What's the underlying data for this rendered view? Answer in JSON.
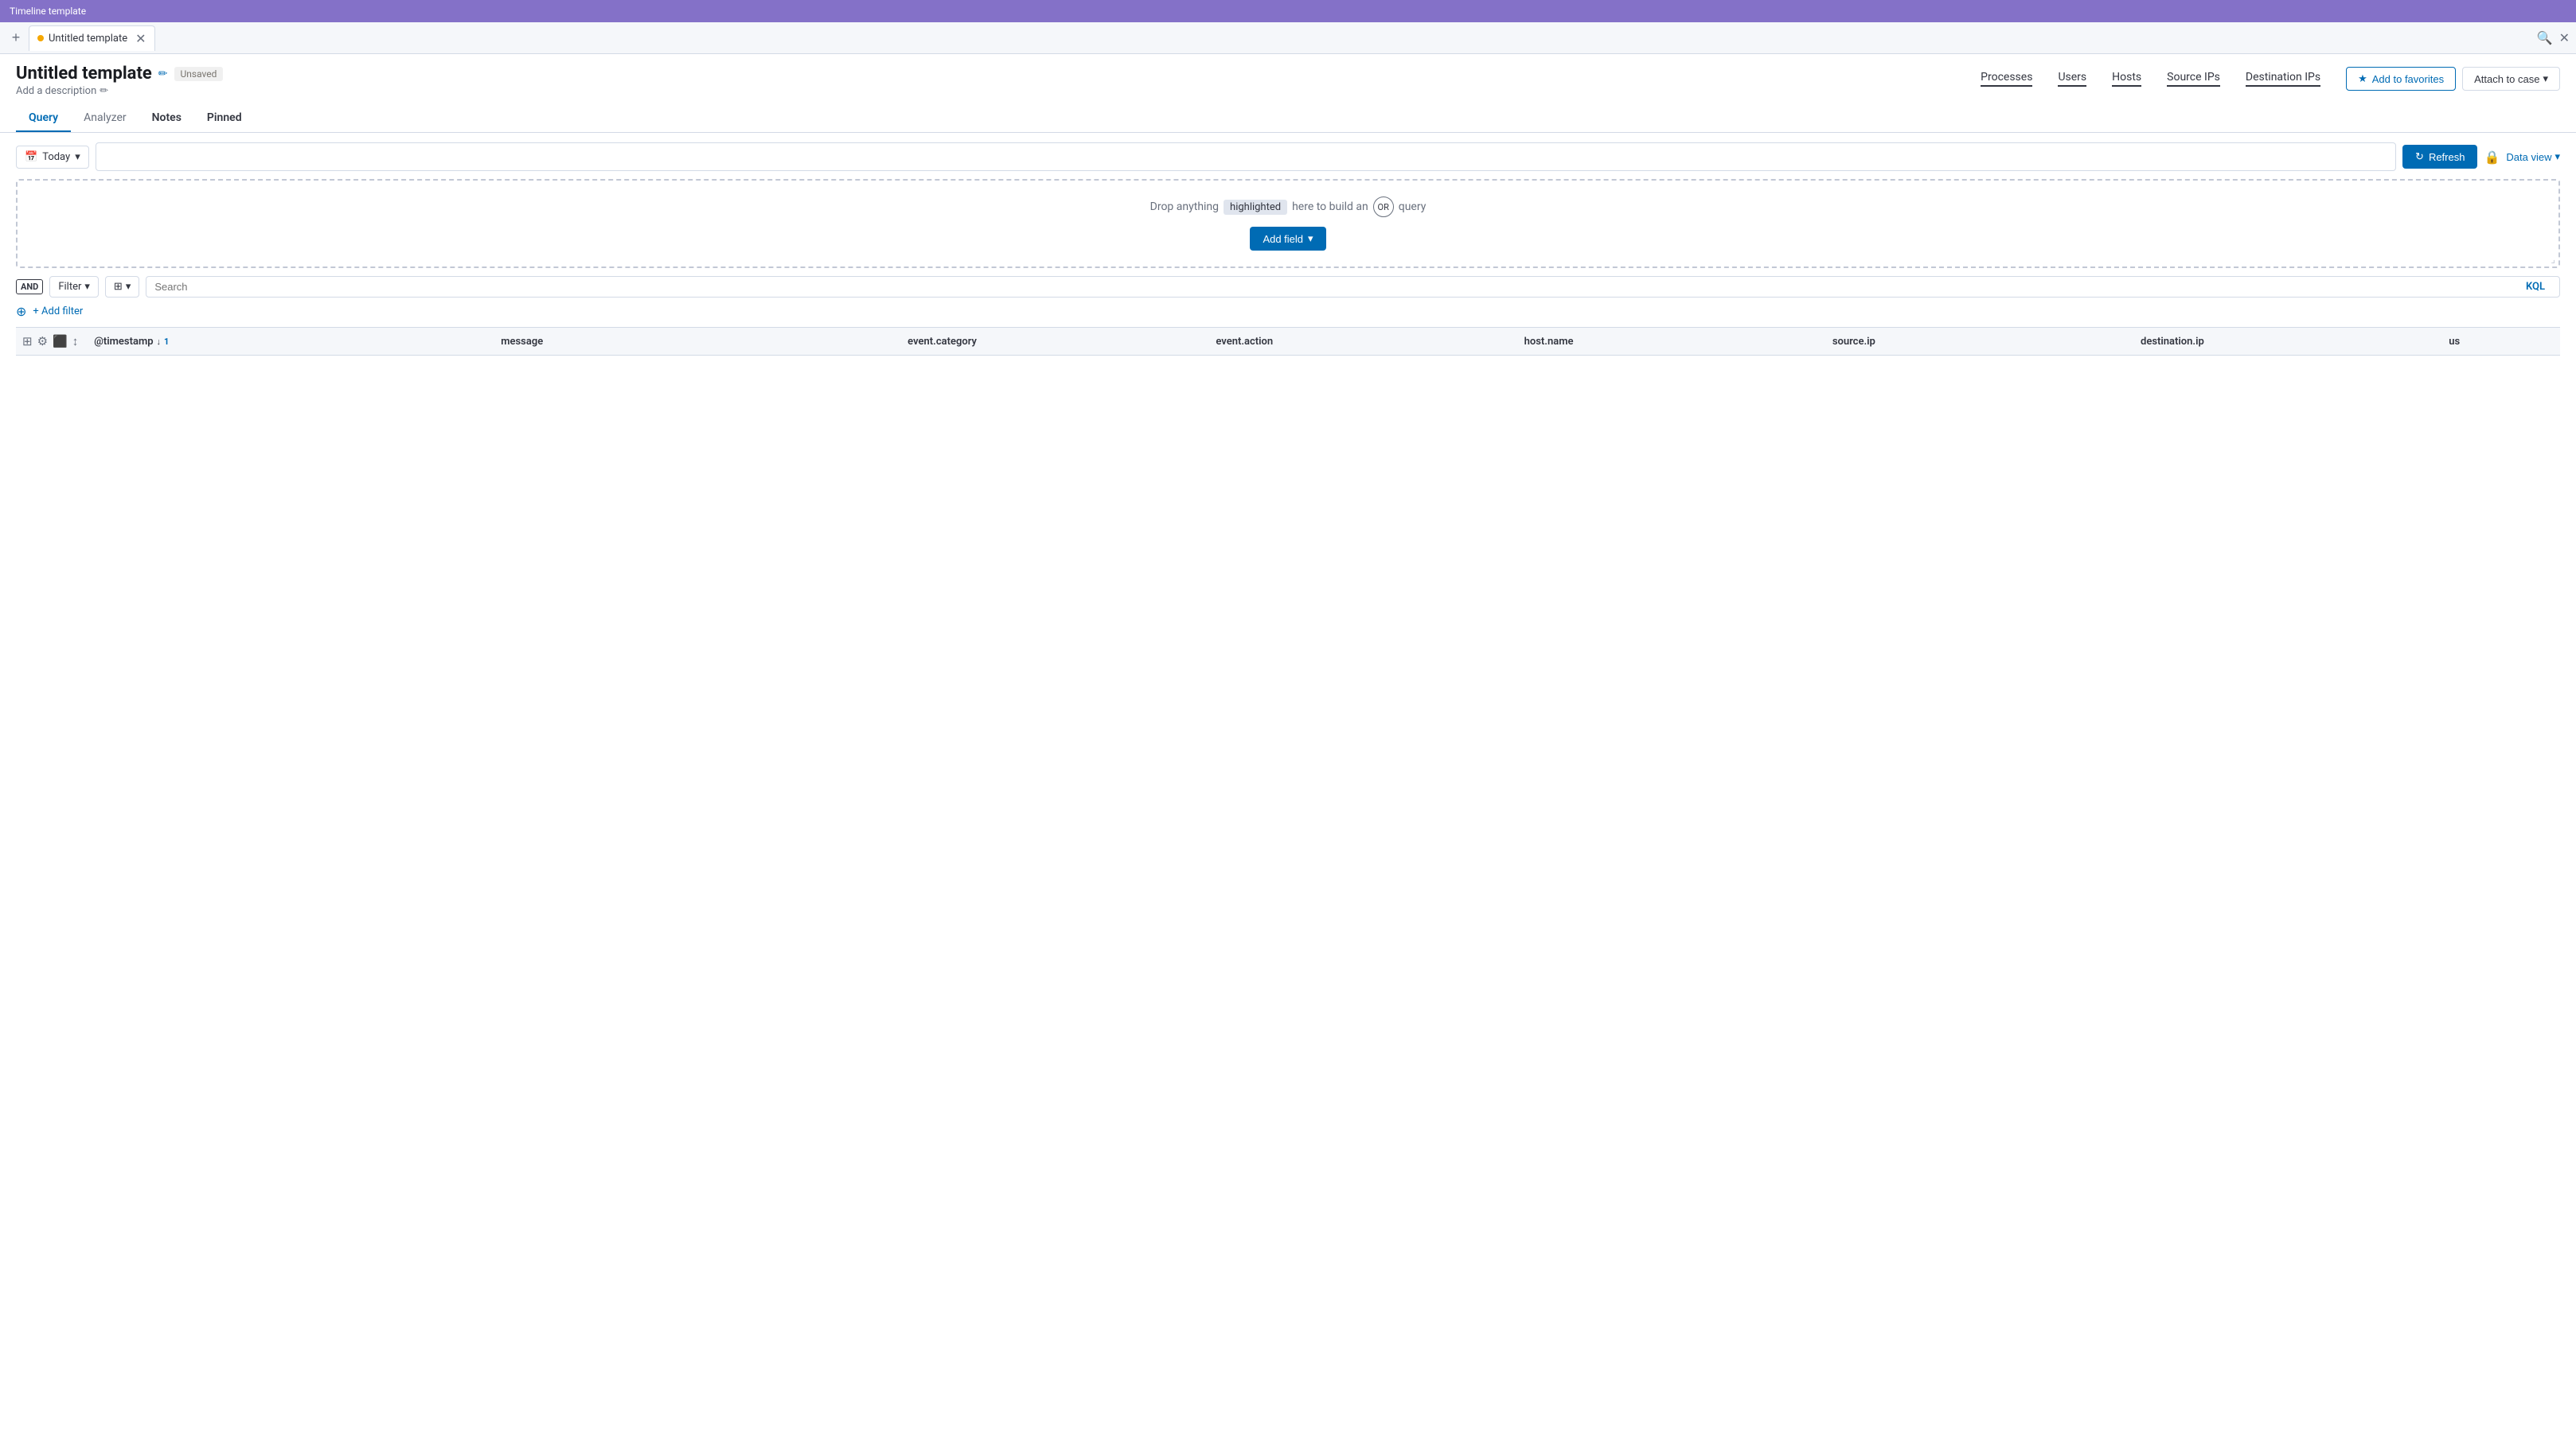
{
  "topBar": {
    "title": "Timeline template"
  },
  "tabs": {
    "addButton": "+",
    "activeTab": {
      "dot": true,
      "label": "Untitled template"
    },
    "actions": {
      "searchIcon": "🔍",
      "closeIcon": "✕"
    }
  },
  "header": {
    "title": "Untitled template",
    "editIcon": "✏",
    "unsavedLabel": "Unsaved",
    "addDescription": "Add a description",
    "pencilIcon": "✏",
    "navMetrics": [
      {
        "label": "Processes"
      },
      {
        "label": "Users"
      },
      {
        "label": "Hosts"
      },
      {
        "label": "Source IPs"
      },
      {
        "label": "Destination IPs"
      }
    ],
    "actions": {
      "starIcon": "★",
      "addToFavorites": "Add to favorites",
      "attachToCase": "Attach to case",
      "chevronIcon": "▾"
    }
  },
  "subTabs": [
    {
      "label": "Query",
      "active": true
    },
    {
      "label": "Analyzer",
      "active": false
    },
    {
      "label": "Notes",
      "active": false,
      "bold": true
    },
    {
      "label": "Pinned",
      "active": false,
      "bold": true
    }
  ],
  "toolbar": {
    "dateIcon": "📅",
    "dateValue": "Today",
    "chevronIcon": "▾",
    "refreshIcon": "↻",
    "refreshLabel": "Refresh",
    "lockIcon": "🔒",
    "dataViewLabel": "Data view",
    "dataViewChevron": "▾"
  },
  "dropZone": {
    "preText": "Drop anything",
    "highlighted": "highlighted",
    "midText": "here to build an",
    "orLabel": "OR",
    "postText": "query",
    "addFieldLabel": "Add field",
    "addFieldChevron": "▾"
  },
  "filterBar": {
    "andLabel": "AND",
    "filterLabel": "Filter",
    "filterChevron": "▾",
    "gridIcon": "⊞",
    "gridChevron": "▾",
    "searchPlaceholder": "Search",
    "kqlLabel": "KQL",
    "addFilterCircleIcon": "⊕",
    "addFilterLabel": "+ Add filter"
  },
  "tableHeader": {
    "controls": [
      "⊞",
      "⚙",
      "⬛",
      "↕"
    ],
    "columns": [
      {
        "key": "@timestamp",
        "label": "@timestamp",
        "sortIcon": "↓",
        "sortNum": "1"
      },
      {
        "key": "message",
        "label": "message"
      },
      {
        "key": "event.category",
        "label": "event.category"
      },
      {
        "key": "event.action",
        "label": "event.action"
      },
      {
        "key": "host.name",
        "label": "host.name"
      },
      {
        "key": "source.ip",
        "label": "source.ip"
      },
      {
        "key": "destination.ip",
        "label": "destination.ip"
      },
      {
        "key": "us",
        "label": "us"
      }
    ]
  }
}
